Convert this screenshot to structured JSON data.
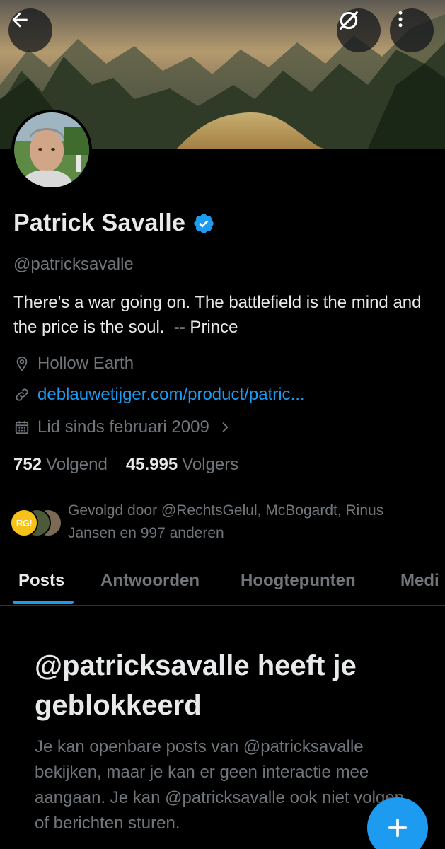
{
  "profile": {
    "display_name": "Patrick Savalle",
    "handle": "@patricksavalle",
    "bio": "There's a war going on. The battlefield is the mind and the price is the soul.  -- Prince",
    "location": "Hollow Earth",
    "website": "deblauwetijger.com/product/patric...",
    "joined": "Lid sinds februari 2009",
    "following_count": "752",
    "following_label": "Volgend",
    "followers_count": "45.995",
    "followers_label": "Volgers",
    "followed_by": "Gevolgd door @RechtsGelul, McBogardt, Rinus Jansen en 997 anderen",
    "followed_by_avatar_text": "RG!"
  },
  "tabs": [
    {
      "label": "Posts",
      "active": true
    },
    {
      "label": "Antwoorden",
      "active": false
    },
    {
      "label": "Hoogtepunten",
      "active": false
    },
    {
      "label": "Medi",
      "active": false
    }
  ],
  "blocked": {
    "title": "@patricksavalle heeft je geblokkeerd",
    "description": "Je kan openbare posts van @patricksavalle bekijken, maar je kan er geen interactie mee aangaan. Je kan @patricksavalle ook niet volgen of berichten sturen."
  },
  "icons": {
    "back": "arrow-left-icon",
    "grok": "grok-icon",
    "more": "more-vertical-icon",
    "verified": "verified-badge-icon",
    "location": "location-pin-icon",
    "link": "link-icon",
    "calendar": "calendar-icon",
    "chevron": "chevron-right-icon",
    "compose": "plus-icon"
  },
  "colors": {
    "accent": "#1d9bf0",
    "background": "#000000",
    "text_primary": "#e7e9ea",
    "text_secondary": "#71767b"
  }
}
